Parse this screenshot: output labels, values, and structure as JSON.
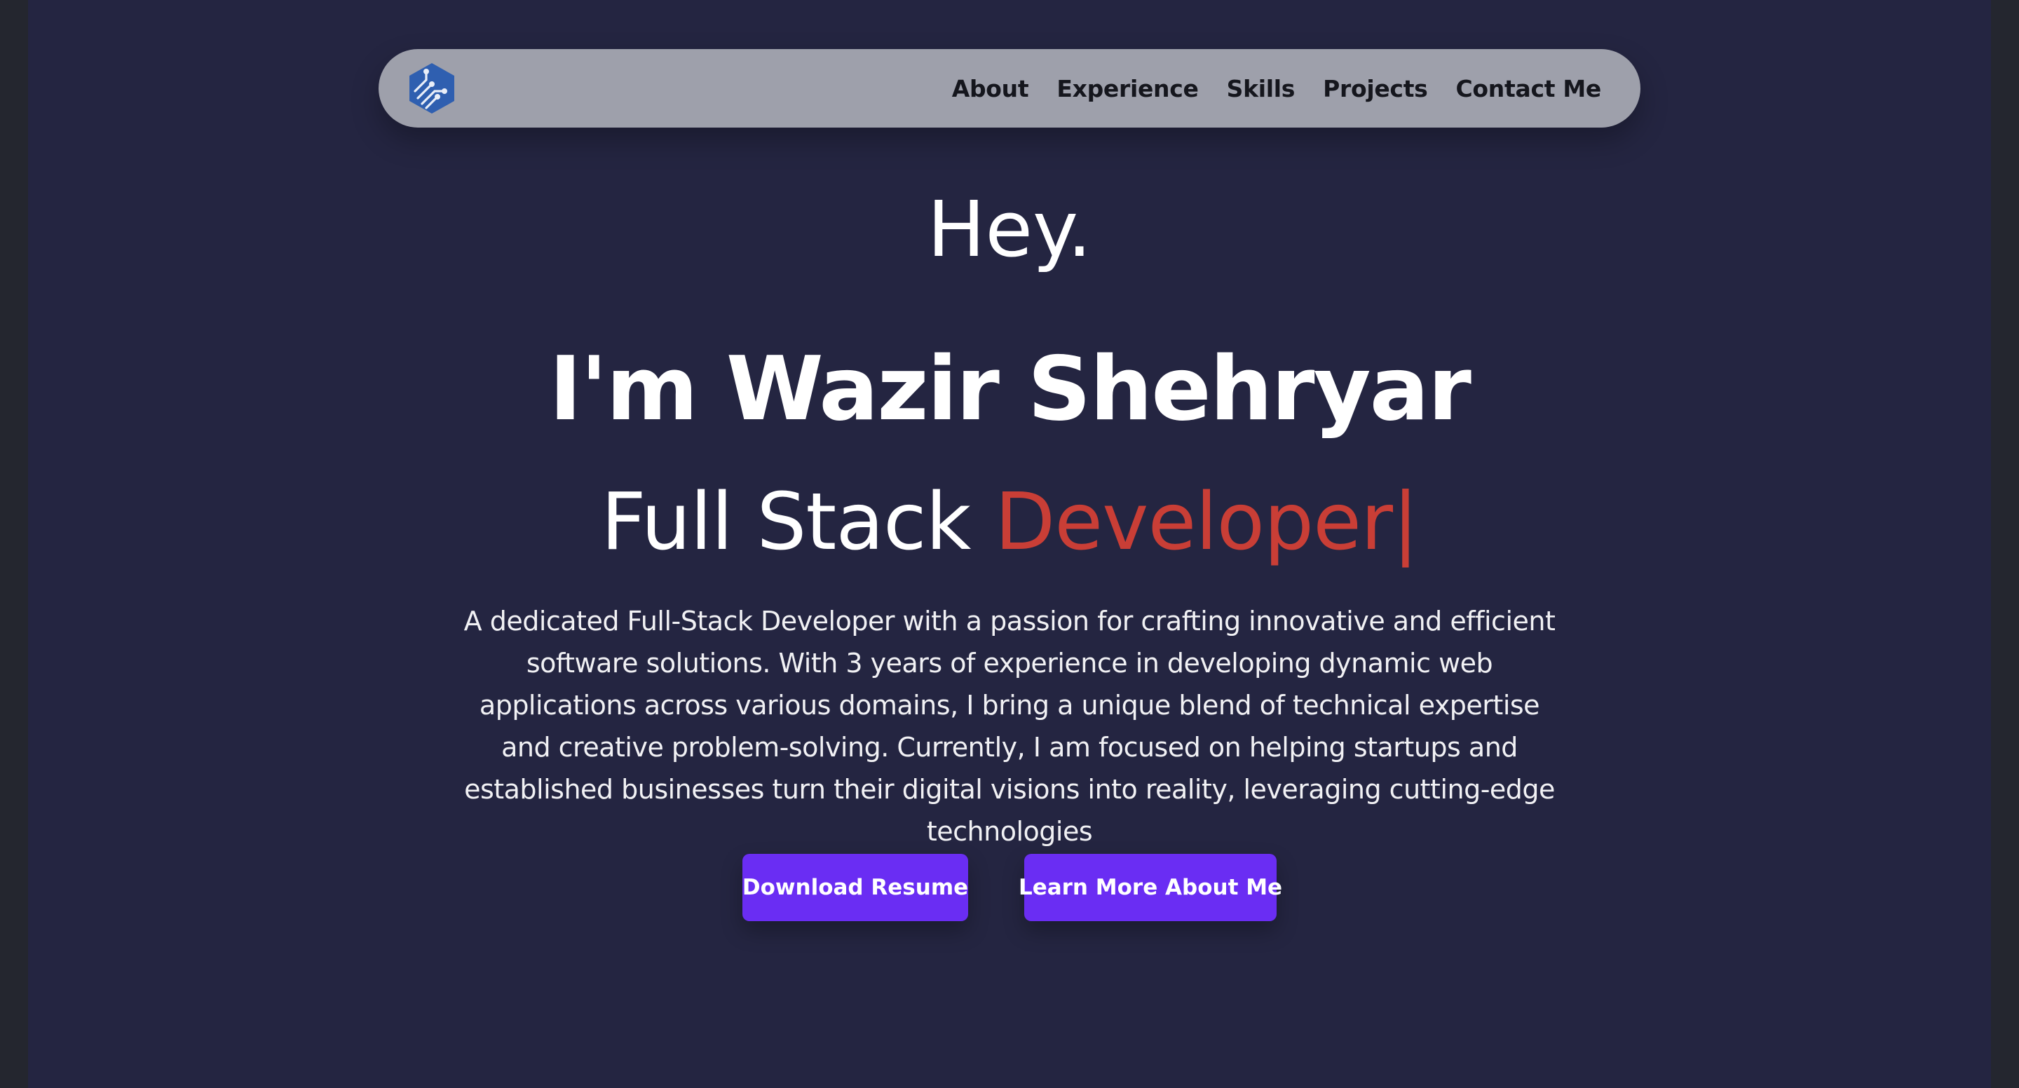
{
  "nav": {
    "logo": "hexagon-circuit-logo",
    "links": [
      "About",
      "Experience",
      "Skills",
      "Projects",
      "Contact Me"
    ]
  },
  "hero": {
    "greeting": "Hey.",
    "name": "I'm Wazir Shehryar",
    "role_prefix": "Full Stack",
    "role_highlight": "Developer",
    "cursor": "|",
    "description": "A dedicated Full-Stack Developer with a passion for crafting innovative and efficient software solutions. With 3 years of experience in developing dynamic web applications across various domains, I bring a unique blend of technical expertise and creative problem-solving. Currently, I am focused on helping startups and established businesses turn their digital visions into reality, leveraging cutting-edge technologies"
  },
  "buttons": {
    "download": "Download Resume",
    "learn": "Learn More About Me"
  },
  "colors": {
    "background": "#242541",
    "navbar": "#9ea0ab",
    "accent": "#c93e36",
    "button": "#6a2df3",
    "logo": "#2f5fb0"
  }
}
